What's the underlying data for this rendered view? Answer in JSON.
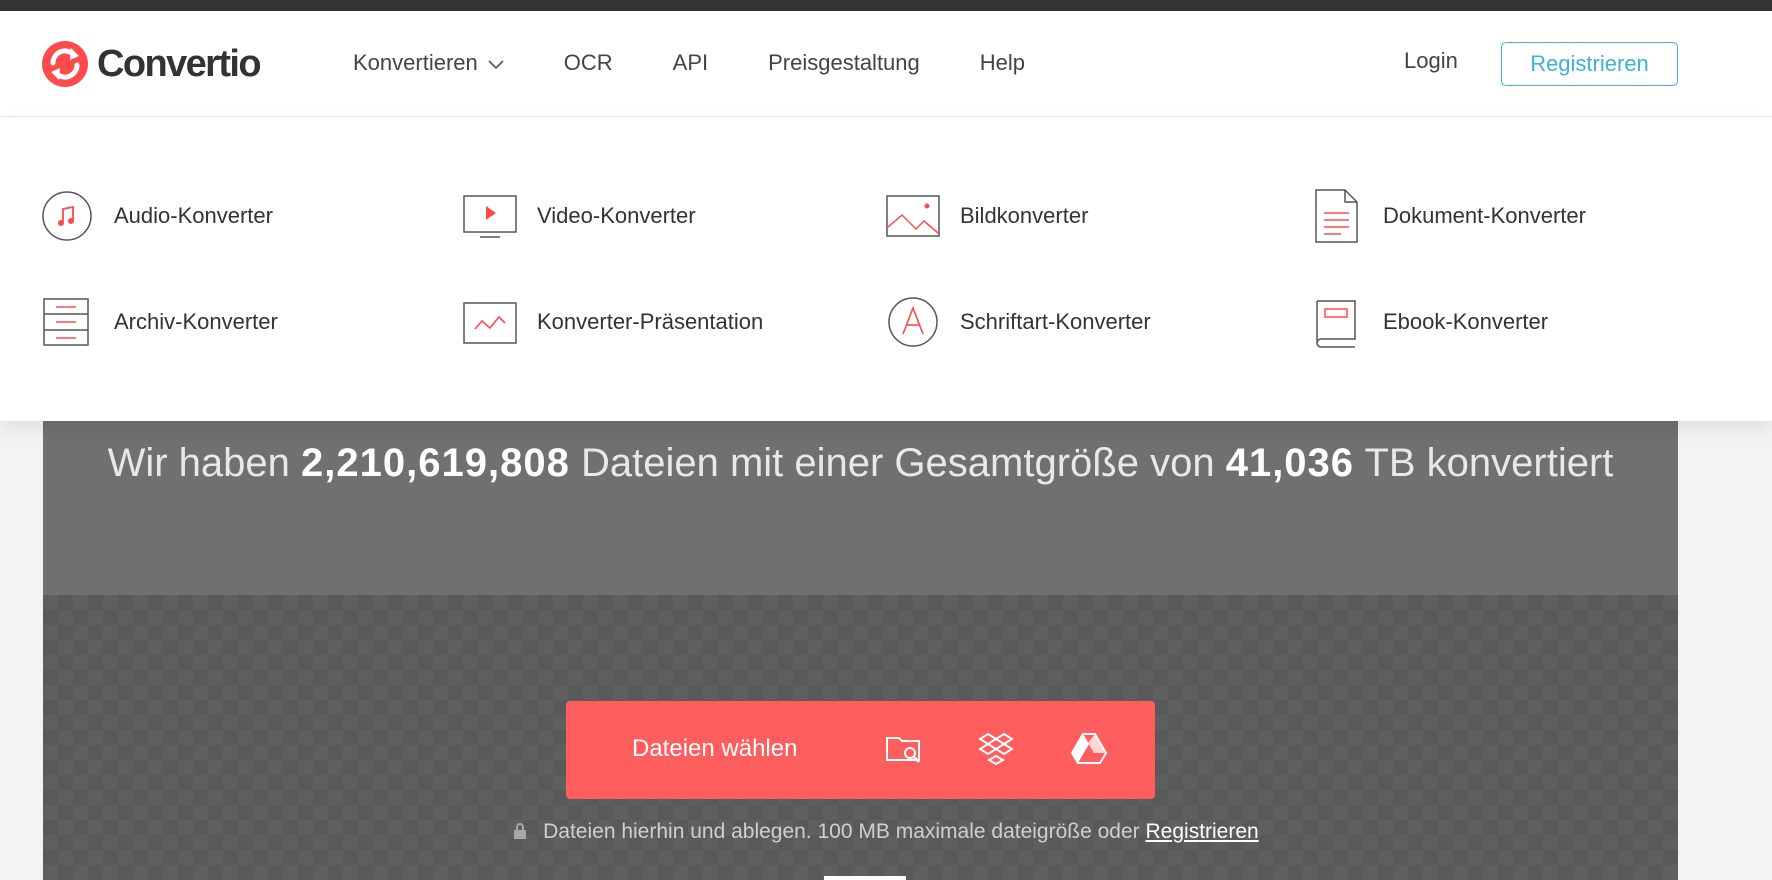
{
  "header": {
    "brand": "Convertio",
    "nav": [
      {
        "label": "Konvertieren",
        "has_dropdown": true
      },
      {
        "label": "OCR"
      },
      {
        "label": "API"
      },
      {
        "label": "Preisgestaltung"
      },
      {
        "label": "Help"
      }
    ],
    "login": "Login",
    "register": "Registrieren"
  },
  "dropdown": {
    "items": [
      {
        "label": "Audio-Konverter",
        "icon": "music-note-icon"
      },
      {
        "label": "Video-Konverter",
        "icon": "video-play-icon"
      },
      {
        "label": "Bildkonverter",
        "icon": "image-icon"
      },
      {
        "label": "Dokument-Konverter",
        "icon": "document-icon"
      },
      {
        "label": "Archiv-Konverter",
        "icon": "archive-icon"
      },
      {
        "label": "Konverter-Präsentation",
        "icon": "presentation-chart-icon"
      },
      {
        "label": "Schriftart-Konverter",
        "icon": "font-icon"
      },
      {
        "label": "Ebook-Konverter",
        "icon": "ebook-icon"
      }
    ]
  },
  "hero": {
    "stats_prefix": "Wir haben",
    "files_count": "2,210,619,808",
    "stats_middle": "Dateien mit einer Gesamtgröße von",
    "total_size": "41,036",
    "stats_suffix": "TB konvertiert",
    "choose_files": "Dateien wählen",
    "hint_text": "Dateien hierhin und ablegen. 100 MB maximale dateigröße oder",
    "hint_link": "Registrieren"
  },
  "colors": {
    "accent_red": "#ff5e5e",
    "register_blue": "#3bb4d7",
    "hero_gray": "#707070"
  }
}
